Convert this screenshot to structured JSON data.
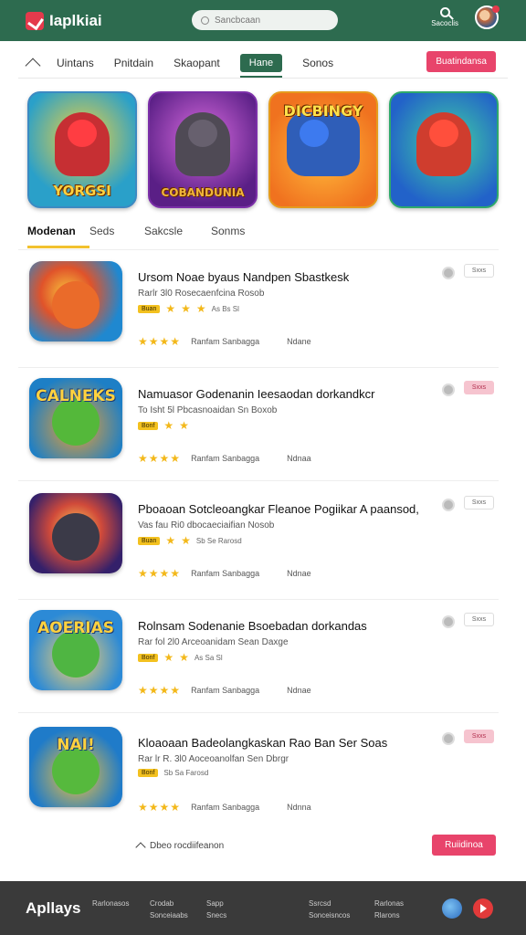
{
  "header": {
    "logo_text": "Iaplkiai",
    "search_placeholder": "Sancbcaan",
    "search_label": "Sacoclis"
  },
  "nav": {
    "items": [
      "Uintans",
      "Pnitdain",
      "Skaopant"
    ],
    "active": "Hane",
    "last": "Sonos",
    "cta": "Buatindansa"
  },
  "featured": [
    {
      "title": "YORGSI"
    },
    {
      "title": "COBANDUNIA"
    },
    {
      "title": "DICBINGY"
    },
    {
      "title": ""
    }
  ],
  "subtabs": [
    "Modenan",
    "Seds",
    "Sakcsle",
    "Sonms"
  ],
  "apps": [
    {
      "icon_label": "",
      "title": "Ursom Noae byaus Nandpen Sbastkesk",
      "desc": "Rarlr 3l0 Rosecaenfcina Rosob",
      "badge": "Buan",
      "mini": "As Bs Sl",
      "developer": "Ranfam Sanbagga",
      "category": "Ndane",
      "btn": "Sxxs",
      "btn_pink": false,
      "stars": 3
    },
    {
      "icon_label": "CALNEKS",
      "title": "Namuasor Godenanin Ieesaodan dorkandkcr",
      "desc": "To Isht 5l Pbcasnoaidan Sn Boxob",
      "badge": "Bonf",
      "mini": "",
      "developer": "Ranfam Sanbagga",
      "category": "Ndnaa",
      "btn": "Sxxs",
      "btn_pink": true,
      "stars": 2
    },
    {
      "icon_label": "",
      "title": "Pboaoan Sotcleoangkar Fleanoe Pogiikar A paansod,",
      "desc": "Vas fau Ri0 dbocaeciaifian Nosob",
      "badge": "Buan",
      "mini": "Sb Se Rarosd",
      "developer": "Ranfam Sanbagga",
      "category": "Ndnae",
      "btn": "Sxxs",
      "btn_pink": false,
      "stars": 2
    },
    {
      "icon_label": "AOERIAS",
      "title": "Rolnsam Sodenanie Bsoebadan dorkandas",
      "desc": "Rar fol 2l0 Arceoanidam Sean Daxge",
      "badge": "Bonf",
      "mini": "As Sa Sl",
      "developer": "Ranfam Sanbagga",
      "category": "Ndnae",
      "btn": "Sxxs",
      "btn_pink": false,
      "stars": 2
    },
    {
      "icon_label": "NAI!",
      "title": "Kloaoaan Badeolangkaskan Rao Ban Ser Soas",
      "desc": "Rar lr R. 3l0 Aoceoanolfan Sen Dbrgr",
      "badge": "Bonf",
      "mini": "Sb Sa Farosd",
      "developer": "Ranfam Sanbagga",
      "category": "Ndnna",
      "btn": "Sxxs",
      "btn_pink": true,
      "stars": 0
    }
  ],
  "more": {
    "label": "Dbeo rocdiifeanon",
    "cta": "Ruiidinoa"
  },
  "footer": {
    "logo": "Apllays",
    "col1": [
      "Rarlonasos"
    ],
    "col2": [
      "Crodab",
      "Sonceiaabs"
    ],
    "col3": [
      "Sapp",
      "Snecs"
    ],
    "col4": [
      "Ssrcsd",
      "Sonceisncos"
    ],
    "col5": [
      "Rarlonas",
      "Rlarons"
    ]
  },
  "colors": {
    "header_bg": "#2d6b4f",
    "accent_pink": "#e8446b",
    "star": "#f3b81a",
    "footer_bg": "#3a3a3a"
  }
}
